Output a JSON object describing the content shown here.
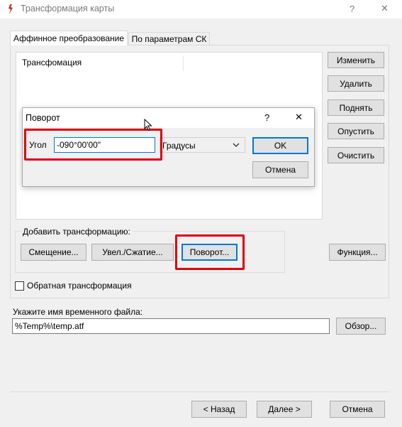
{
  "window": {
    "title": "Трансформация карты",
    "help": "?",
    "close": "✕"
  },
  "tabs": [
    {
      "label": "Аффинное преобразование",
      "active": true
    },
    {
      "label": "По параметрам СК",
      "active": false
    }
  ],
  "list": {
    "header": "Трансфомация"
  },
  "side_buttons": {
    "edit": "Изменить",
    "delete": "Удалить",
    "up": "Поднять",
    "down": "Опустить",
    "clear": "Очистить"
  },
  "add_group": {
    "label": "Добавить трансформацию:",
    "shift": "Смещение...",
    "scale": "Увел./Сжатие...",
    "rotate": "Поворот...",
    "function": "Функция..."
  },
  "inverse": {
    "label": "Обратная трансформация",
    "checked": false
  },
  "temp_file": {
    "label": "Укажите имя временного файла:",
    "value": "%Temp%\\temp.atf",
    "browse": "Обзор..."
  },
  "footer": {
    "back": "< Назад",
    "next": "Далее >",
    "cancel": "Отмена"
  },
  "rotate_dialog": {
    "title": "Поворот",
    "help": "?",
    "close": "✕",
    "angle_label": "Угол",
    "angle_value": "-090°00'00\"",
    "units_selected": "Градусы",
    "ok": "OK",
    "cancel": "Отмена"
  },
  "colors": {
    "highlight": "#e0000f",
    "accent": "#0078d7",
    "app_icon": "#c0392b"
  }
}
